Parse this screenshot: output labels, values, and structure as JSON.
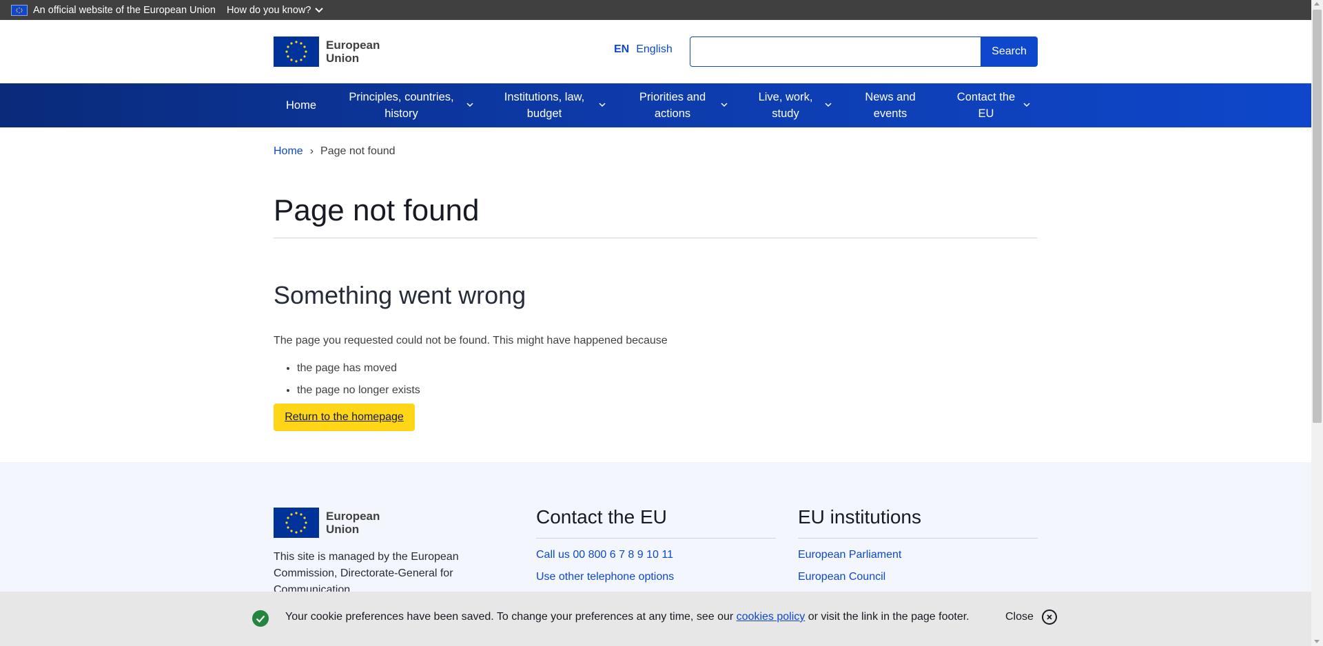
{
  "global_banner": {
    "official_text": "An official website of the European Union",
    "how_text": "How do you know?"
  },
  "header": {
    "logo_line1": "European",
    "logo_line2": "Union",
    "language_code": "EN",
    "language_name": "English",
    "search_placeholder": "",
    "search_button": "Search"
  },
  "nav": {
    "items": [
      {
        "label_line1": "Home",
        "label_line2": ""
      },
      {
        "label_line1": "Principles, countries,",
        "label_line2": "history"
      },
      {
        "label_line1": "Institutions, law,",
        "label_line2": "budget"
      },
      {
        "label_line1": "Priorities and",
        "label_line2": "actions"
      },
      {
        "label_line1": "Live, work,",
        "label_line2": "study"
      },
      {
        "label_line1": "News and",
        "label_line2": "events"
      },
      {
        "label_line1": "Contact the",
        "label_line2": "EU"
      }
    ]
  },
  "breadcrumb": {
    "home": "Home",
    "separator": "›",
    "current": "Page not found"
  },
  "main": {
    "title": "Page not found",
    "heading": "Something went wrong",
    "intro": "The page you requested could not be found. This might have happened because",
    "reasons": [
      "the page has moved",
      "the page no longer exists"
    ],
    "button": "Return to the homepage"
  },
  "footer": {
    "logo_line1": "European",
    "logo_line2": "Union",
    "description": "This site is managed by the European Commission, Directorate-General for Communication",
    "contact": {
      "title": "Contact the EU",
      "links": [
        "Call us 00 800 6 7 8 9 10 11",
        "Use other telephone options"
      ]
    },
    "institutions": {
      "title": "EU institutions",
      "links": [
        "European Parliament",
        "European Council"
      ]
    }
  },
  "cookie": {
    "text_before": "Your cookie preferences have been saved. To change your preferences at any time, see our ",
    "link_text": "cookies policy",
    "text_after": " or visit the link in the page footer.",
    "close_label": "Close"
  },
  "colors": {
    "primary": "#0e47cb",
    "eu_flag": "#003399",
    "star": "#ffd617",
    "button_yellow": "#ffd617",
    "success": "#24853e"
  }
}
